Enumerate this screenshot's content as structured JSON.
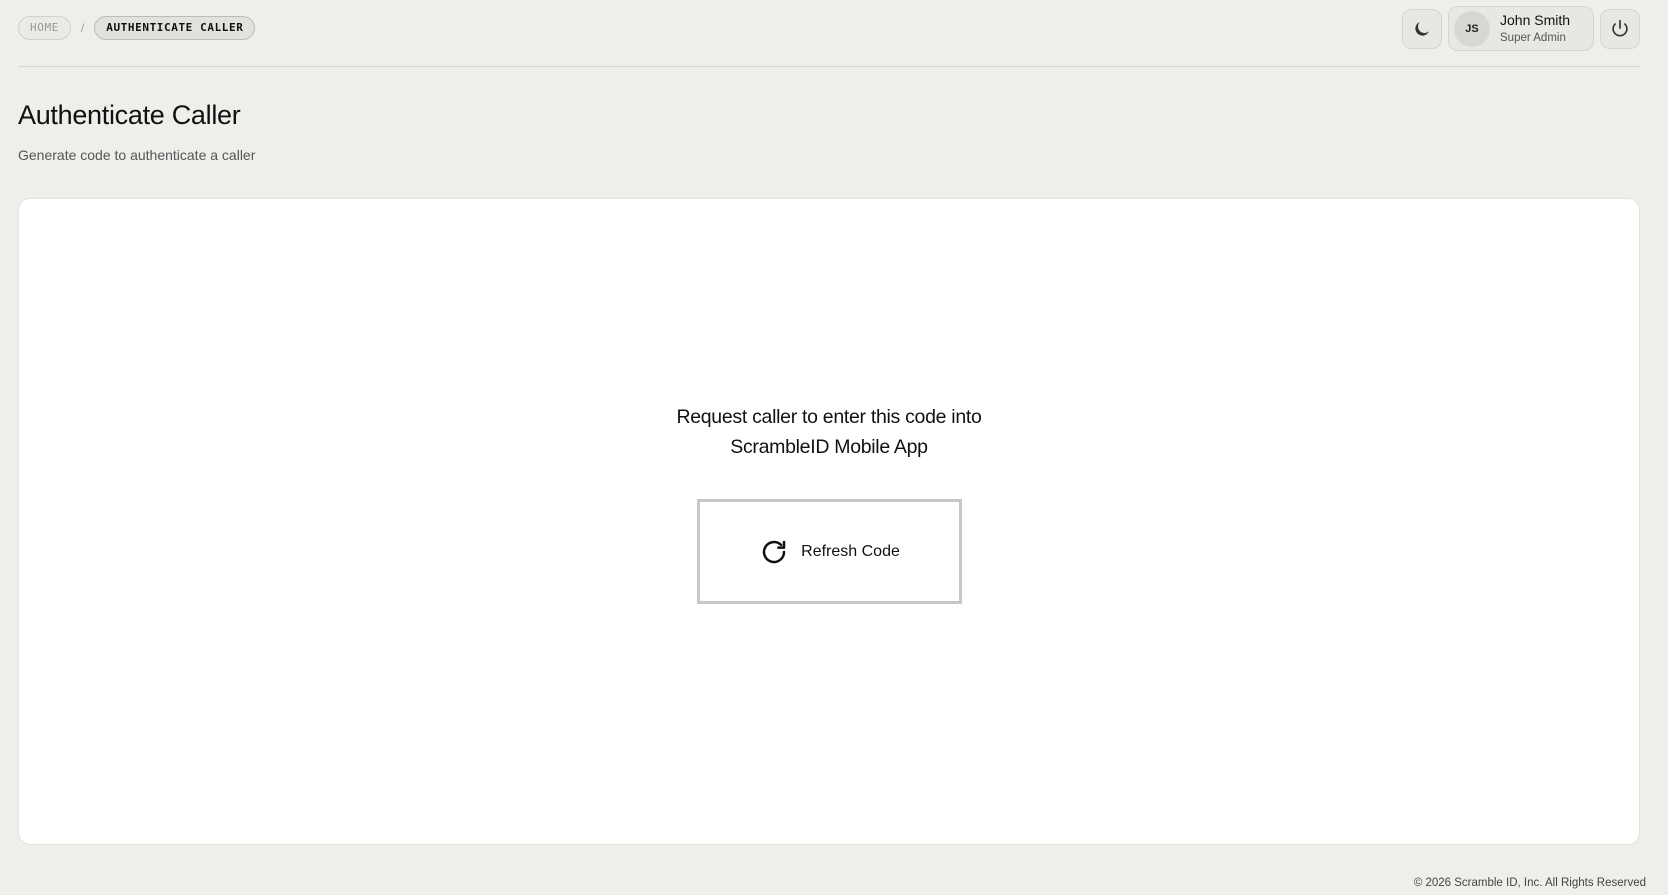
{
  "breadcrumb": {
    "home": "HOME",
    "separator": "/",
    "current": "AUTHENTICATE CALLER"
  },
  "header": {
    "theme_toggle_icon": "moon-icon",
    "user": {
      "initials": "JS",
      "name": "John Smith",
      "role": "Super Admin"
    },
    "logout_icon": "power-icon"
  },
  "page": {
    "title": "Authenticate Caller",
    "subtitle": "Generate code to authenticate a caller"
  },
  "card": {
    "instruction_line1": "Request caller to enter this code into",
    "instruction_line2": "ScrambleID Mobile App",
    "refresh_label": "Refresh Code",
    "refresh_icon": "refresh-icon"
  },
  "footer": {
    "copyright": "© 2026 Scramble ID, Inc. All Rights Reserved"
  },
  "colors": {
    "background": "#efeeeb",
    "card": "#ffffff",
    "button_border": "#c7c7c7"
  }
}
